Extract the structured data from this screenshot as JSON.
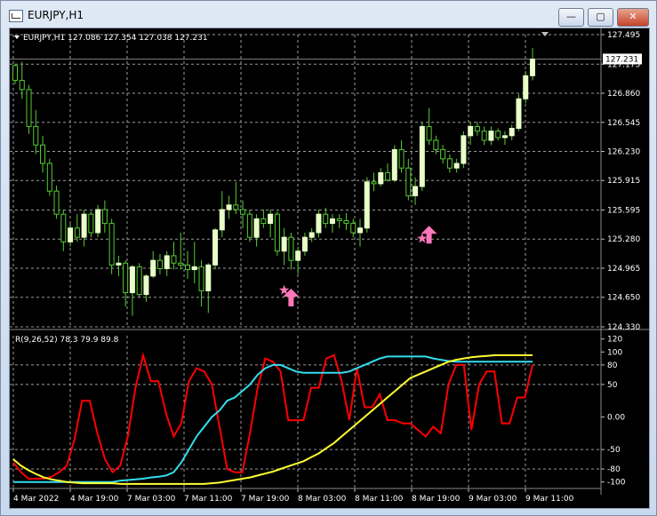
{
  "window": {
    "title": "EURJPY,H1"
  },
  "window_buttons": {
    "minimize": "—",
    "maximize": "▢",
    "close": "✕"
  },
  "chart_data": [
    {
      "type": "candlestick",
      "symbol": "EURJPY,H1",
      "header": "EURJPY,H1  127.086 127.354 127.038 127.231",
      "ylim": [
        124.33,
        127.495
      ],
      "y_ticks": [
        "127.495",
        "127.175",
        "126.860",
        "126.545",
        "126.230",
        "125.915",
        "125.595",
        "125.280",
        "124.965",
        "124.650",
        "124.330"
      ],
      "current_price": "127.231",
      "grid": true,
      "candles": [
        [
          127.16,
          127.18,
          126.96,
          127.0
        ],
        [
          127.0,
          127.2,
          126.8,
          126.9
        ],
        [
          126.9,
          126.95,
          126.42,
          126.5
        ],
        [
          126.5,
          126.68,
          126.2,
          126.3
        ],
        [
          126.3,
          126.4,
          126.0,
          126.1
        ],
        [
          126.1,
          126.15,
          125.75,
          125.8
        ],
        [
          125.8,
          125.86,
          125.5,
          125.55
        ],
        [
          125.55,
          125.6,
          125.15,
          125.25
        ],
        [
          125.25,
          125.45,
          125.2,
          125.4
        ],
        [
          125.4,
          125.55,
          125.25,
          125.3
        ],
        [
          125.3,
          125.6,
          125.2,
          125.55
        ],
        [
          125.55,
          125.58,
          125.3,
          125.35
        ],
        [
          125.35,
          125.65,
          125.3,
          125.6
        ],
        [
          125.6,
          125.7,
          125.35,
          125.45
        ],
        [
          125.45,
          125.5,
          124.9,
          125.0
        ],
        [
          125.0,
          125.1,
          124.88,
          125.02
        ],
        [
          125.02,
          125.05,
          124.55,
          124.7
        ],
        [
          124.7,
          125.0,
          124.45,
          124.98
        ],
        [
          124.98,
          125.02,
          124.65,
          124.68
        ],
        [
          124.68,
          124.9,
          124.6,
          124.88
        ],
        [
          124.88,
          125.15,
          124.86,
          125.05
        ],
        [
          125.05,
          125.12,
          124.9,
          124.96
        ],
        [
          124.96,
          125.15,
          124.88,
          125.1
        ],
        [
          125.1,
          125.25,
          124.95,
          125.02
        ],
        [
          125.02,
          125.35,
          124.95,
          125.0
        ],
        [
          125.0,
          125.15,
          124.85,
          124.95
        ],
        [
          124.95,
          125.25,
          124.8,
          124.98
        ],
        [
          124.98,
          125.05,
          124.55,
          124.72
        ],
        [
          124.72,
          125.02,
          124.48,
          125.0
        ],
        [
          125.0,
          125.4,
          124.95,
          125.38
        ],
        [
          125.38,
          125.8,
          125.3,
          125.6
        ],
        [
          125.6,
          125.75,
          125.5,
          125.65
        ],
        [
          125.65,
          125.9,
          125.55,
          125.6
        ],
        [
          125.6,
          125.7,
          125.4,
          125.55
        ],
        [
          125.55,
          125.6,
          125.25,
          125.3
        ],
        [
          125.3,
          125.55,
          125.2,
          125.5
        ],
        [
          125.5,
          125.6,
          125.4,
          125.45
        ],
        [
          125.45,
          125.6,
          125.3,
          125.55
        ],
        [
          125.55,
          125.58,
          125.1,
          125.15
        ],
        [
          125.15,
          125.4,
          125.0,
          125.3
        ],
        [
          125.3,
          125.35,
          124.95,
          125.05
        ],
        [
          125.05,
          125.2,
          124.9,
          125.15
        ],
        [
          125.15,
          125.35,
          125.1,
          125.3
        ],
        [
          125.3,
          125.4,
          125.25,
          125.35
        ],
        [
          125.35,
          125.6,
          125.3,
          125.55
        ],
        [
          125.55,
          125.62,
          125.4,
          125.45
        ],
        [
          125.45,
          125.55,
          125.35,
          125.5
        ],
        [
          125.5,
          125.55,
          125.4,
          125.48
        ],
        [
          125.48,
          125.56,
          125.38,
          125.45
        ],
        [
          125.45,
          125.5,
          125.3,
          125.35
        ],
        [
          125.35,
          125.5,
          125.2,
          125.4
        ],
        [
          125.4,
          125.95,
          125.35,
          125.9
        ],
        [
          125.9,
          126.0,
          125.8,
          125.88
        ],
        [
          125.88,
          126.05,
          125.85,
          126.0
        ],
        [
          126.0,
          126.1,
          125.9,
          125.92
        ],
        [
          125.92,
          126.3,
          125.9,
          126.25
        ],
        [
          126.25,
          126.35,
          126.0,
          126.05
        ],
        [
          126.05,
          126.15,
          125.7,
          125.75
        ],
        [
          125.75,
          125.95,
          125.65,
          125.85
        ],
        [
          125.85,
          126.55,
          125.8,
          126.5
        ],
        [
          126.5,
          126.7,
          126.3,
          126.35
        ],
        [
          126.35,
          126.4,
          126.2,
          126.25
        ],
        [
          126.25,
          126.3,
          126.1,
          126.15
        ],
        [
          126.15,
          126.2,
          126.0,
          126.05
        ],
        [
          126.05,
          126.15,
          126.0,
          126.1
        ],
        [
          126.1,
          126.45,
          126.05,
          126.4
        ],
        [
          126.4,
          126.55,
          126.3,
          126.5
        ],
        [
          126.5,
          126.55,
          126.4,
          126.45
        ],
        [
          126.45,
          126.5,
          126.3,
          126.35
        ],
        [
          126.35,
          126.5,
          126.3,
          126.45
        ],
        [
          126.45,
          126.48,
          126.35,
          126.38
        ],
        [
          126.38,
          126.45,
          126.3,
          126.4
        ],
        [
          126.4,
          126.52,
          126.35,
          126.48
        ],
        [
          126.48,
          126.85,
          126.45,
          126.8
        ],
        [
          126.8,
          127.1,
          126.75,
          127.05
        ],
        [
          127.05,
          127.35,
          127.0,
          127.23
        ]
      ],
      "markers": [
        {
          "type": "arrow-up",
          "index": 40,
          "price": 124.84
        },
        {
          "type": "star",
          "index": 39,
          "price": 124.9
        },
        {
          "type": "arrow-up",
          "index": 60,
          "price": 125.52
        },
        {
          "type": "star",
          "index": 59,
          "price": 125.46
        }
      ]
    },
    {
      "type": "line",
      "header": "R(9,26,52) 78.3 79.9 89.8",
      "ylim": [
        -110,
        125
      ],
      "y_ticks": [
        "120",
        "100",
        "80",
        "50",
        "0.00",
        "-50",
        "-80",
        "-100"
      ],
      "reference_lines": [
        -80,
        -50,
        50,
        80
      ],
      "series": [
        {
          "color": "#ff0000",
          "values": [
            -70,
            -85,
            -95,
            -95,
            -95,
            -92,
            -85,
            -75,
            -35,
            25,
            25,
            -25,
            -65,
            -85,
            -75,
            -30,
            45,
            95,
            55,
            55,
            5,
            -30,
            -10,
            55,
            75,
            70,
            50,
            -15,
            -80,
            -85,
            -85,
            -25,
            45,
            90,
            85,
            70,
            -5,
            -5,
            -5,
            45,
            45,
            90,
            95,
            55,
            -5,
            75,
            15,
            15,
            35,
            -5,
            -5,
            -10,
            -10,
            -20,
            -30,
            -15,
            -25,
            50,
            80,
            80,
            -20,
            50,
            70,
            70,
            -10,
            -10,
            30,
            30,
            80
          ]
        },
        {
          "color": "#33ddee",
          "values": [
            -100,
            -100,
            -100,
            -100,
            -100,
            -100,
            -100,
            -100,
            -100,
            -100,
            -100,
            -100,
            -100,
            -100,
            -98,
            -97,
            -96,
            -95,
            -93,
            -92,
            -90,
            -85,
            -70,
            -50,
            -30,
            -15,
            0,
            10,
            25,
            30,
            40,
            50,
            65,
            75,
            80,
            80,
            75,
            70,
            68,
            68,
            68,
            68,
            68,
            68,
            70,
            75,
            80,
            85,
            90,
            93,
            93,
            93,
            93,
            93,
            93,
            90,
            88,
            86,
            85,
            85,
            85,
            85,
            85,
            85,
            85,
            85,
            85,
            85,
            85
          ]
        },
        {
          "color": "#ffff33",
          "values": [
            -65,
            -75,
            -82,
            -88,
            -93,
            -96,
            -98,
            -100,
            -101,
            -102,
            -102,
            -102,
            -102,
            -102,
            -103,
            -103,
            -103,
            -103,
            -103,
            -103,
            -103,
            -103,
            -103,
            -103,
            -103,
            -103,
            -102,
            -101,
            -99,
            -97,
            -95,
            -93,
            -90,
            -87,
            -84,
            -80,
            -76,
            -72,
            -68,
            -62,
            -56,
            -48,
            -40,
            -30,
            -20,
            -10,
            0,
            10,
            20,
            30,
            40,
            50,
            60,
            65,
            70,
            75,
            80,
            85,
            88,
            90,
            92,
            93,
            94,
            95,
            95,
            95,
            95,
            95,
            95
          ]
        }
      ]
    }
  ],
  "x_axis": {
    "labels": [
      "4 Mar 2022",
      "4 Mar 19:00",
      "7 Mar 03:00",
      "7 Mar 11:00",
      "7 Mar 19:00",
      "8 Mar 03:00",
      "8 Mar 11:00",
      "8 Mar 19:00",
      "9 Mar 03:00",
      "9 Mar 11:00"
    ]
  },
  "colors": {
    "background": "#000000",
    "grid": "#9a9a9a",
    "bull_candle": "#e8ffc8",
    "wick": "#55cc33",
    "marker": "#ff77bb"
  }
}
